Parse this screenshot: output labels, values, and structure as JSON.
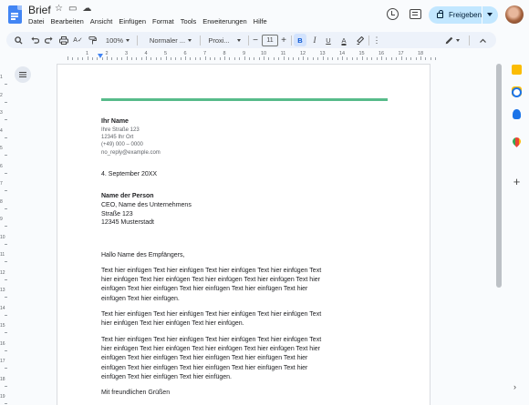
{
  "app": {
    "title": "Brief",
    "menu": [
      "Datei",
      "Bearbeiten",
      "Ansicht",
      "Einfügen",
      "Format",
      "Tools",
      "Erweiterungen",
      "Hilfe"
    ],
    "share_label": "Freigeben"
  },
  "toolbar": {
    "zoom": "100%",
    "style": "Normaler ...",
    "font": "Proxi...",
    "font_size": "11",
    "minus": "−",
    "plus": "+",
    "bold": "B",
    "italic": "I",
    "underline": "U",
    "text_color": "A"
  },
  "ruler": {
    "marks": [
      "1",
      "2",
      "3",
      "4",
      "5",
      "6",
      "7",
      "8",
      "9",
      "10",
      "11",
      "12",
      "13",
      "14",
      "15",
      "16",
      "17",
      "18"
    ],
    "vertical_marks": [
      "1",
      "2",
      "3",
      "4",
      "5",
      "6",
      "7",
      "8",
      "9",
      "10",
      "11",
      "12",
      "13",
      "14",
      "15",
      "16",
      "17",
      "18",
      "19"
    ]
  },
  "letter": {
    "sender_name": "Ihr Name",
    "sender_street": "Ihre Straße 123",
    "sender_city": "12345 Ihr Ort",
    "sender_phone": "(+49) 000 – 0000",
    "sender_email": "no_reply@example.com",
    "date": "4. September 20XX",
    "recipient_name": "Name der Person",
    "recipient_title": "CEO, Name des Unternehmens",
    "recipient_street": "Straße 123",
    "recipient_city": "12345 Musterstadt",
    "salutation": "Hallo Name des Empfängers,",
    "paragraph1": [
      "Text hier einfügen Text hier einfügen Text hier einfügen Text hier einfügen Text",
      "hier einfügen Text hier einfügen Text hier einfügen Text hier einfügen Text hier",
      "einfügen Text hier einfügen Text hier einfügen Text hier einfügen Text hier",
      "einfügen Text hier einfügen."
    ],
    "paragraph2": [
      "Text hier einfügen Text hier einfügen Text hier einfügen Text hier einfügen Text",
      "hier einfügen Text hier einfügen Text hier einfügen."
    ],
    "paragraph3": [
      "Text hier einfügen Text hier einfügen Text hier einfügen Text hier einfügen Text",
      "hier einfügen Text hier einfügen Text hier einfügen Text hier einfügen Text hier",
      "einfügen Text hier einfügen Text hier einfügen Text hier einfügen Text hier",
      "einfügen Text hier einfügen Text hier einfügen Text hier einfügen Text hier",
      "einfügen Text hier einfügen Text hier einfügen."
    ],
    "closing": "Mit freundlichen Grüßen"
  },
  "colors": {
    "accent_rule": "#57bb8a",
    "share_bg": "#c2e7ff",
    "toolbar_bg": "#edf2fa"
  },
  "icons": [
    "docs-logo-icon",
    "star-icon",
    "move-folder-icon",
    "cloud-saved-icon",
    "history-icon",
    "comment-icon",
    "lock-icon",
    "avatar",
    "search-icon",
    "undo-icon",
    "redo-icon",
    "print-icon",
    "spellcheck-icon",
    "paint-format-icon",
    "highlight-icon",
    "more-icon",
    "pen-icon",
    "collapse-icon",
    "outline-icon",
    "calendar-icon",
    "keep-icon",
    "tasks-icon",
    "contacts-icon",
    "maps-icon",
    "add-icon"
  ]
}
